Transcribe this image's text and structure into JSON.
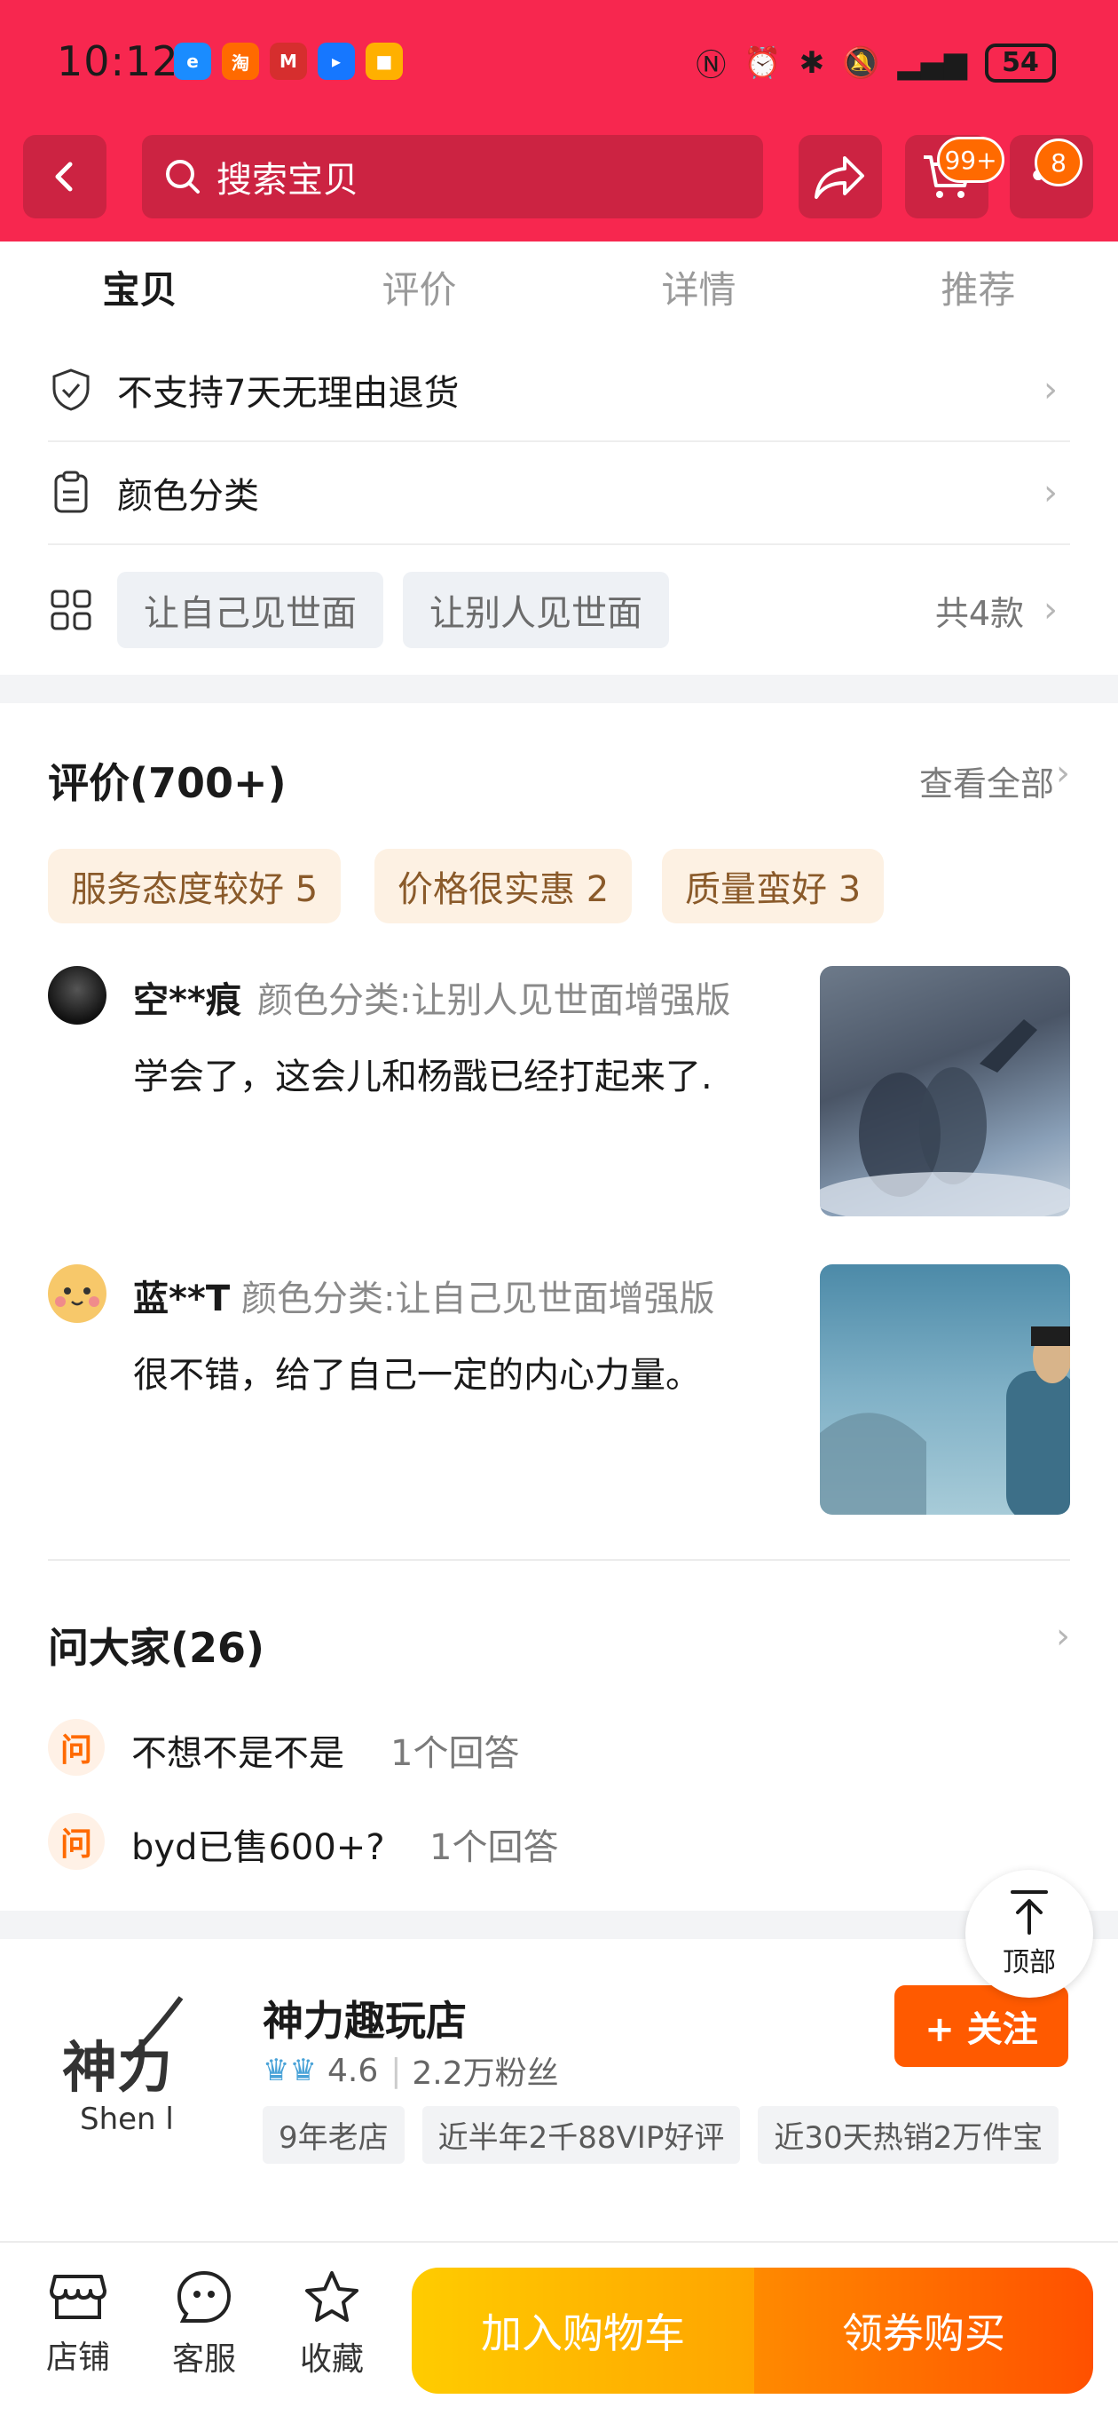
{
  "status_bar": {
    "time": "10:12",
    "battery": "54"
  },
  "header": {
    "search_placeholder": "搜索宝贝",
    "cart_badge": "99+",
    "messages_badge": "8"
  },
  "tabs": [
    {
      "label": "宝贝",
      "active": true
    },
    {
      "label": "评价",
      "active": false
    },
    {
      "label": "详情",
      "active": false
    },
    {
      "label": "推荐",
      "active": false
    }
  ],
  "specs": {
    "return_policy": "不支持7天无理由退货",
    "color_category": "颜色分类",
    "options": [
      "让自己见世面",
      "让别人见世面"
    ],
    "options_count": "共4款"
  },
  "reviews": {
    "title": "评价(700+)",
    "see_all": "查看全部",
    "tags": [
      "服务态度较好 5",
      "价格很实惠 2",
      "质量蛮好 3"
    ],
    "items": [
      {
        "user": "空**痕",
        "meta": "颜色分类:让别人见世面增强版",
        "text": "学会了，这会儿和杨戬已经打起来了."
      },
      {
        "user": "蓝**T",
        "meta": "颜色分类:让自己见世面增强版",
        "text": "很不错，给了自己一定的内心力量。"
      }
    ]
  },
  "questions": {
    "title": "问大家(26)",
    "badge": "问",
    "items": [
      {
        "q": "不想不是不是",
        "answers": "1个回答"
      },
      {
        "q": "byd已售600+?",
        "answers": "1个回答"
      }
    ]
  },
  "store": {
    "logo_text": "神力",
    "logo_sub": "Shen l",
    "name": "神力趣玩店",
    "rating": "4.6",
    "fans": "2.2万粉丝",
    "tags": [
      "9年老店",
      "近半年2千88VIP好评",
      "近30天热销2万件宝"
    ],
    "follow_label": "+ 关注"
  },
  "back_to_top": "顶部",
  "bottom_bar": {
    "store": "店铺",
    "service": "客服",
    "favorite": "收藏",
    "add_to_cart": "加入购物车",
    "buy": "领券购买"
  },
  "colors": {
    "header_bg": "#f7274f",
    "accent_orange": "#ff5a00",
    "cart_yellow": "#ffb800"
  }
}
